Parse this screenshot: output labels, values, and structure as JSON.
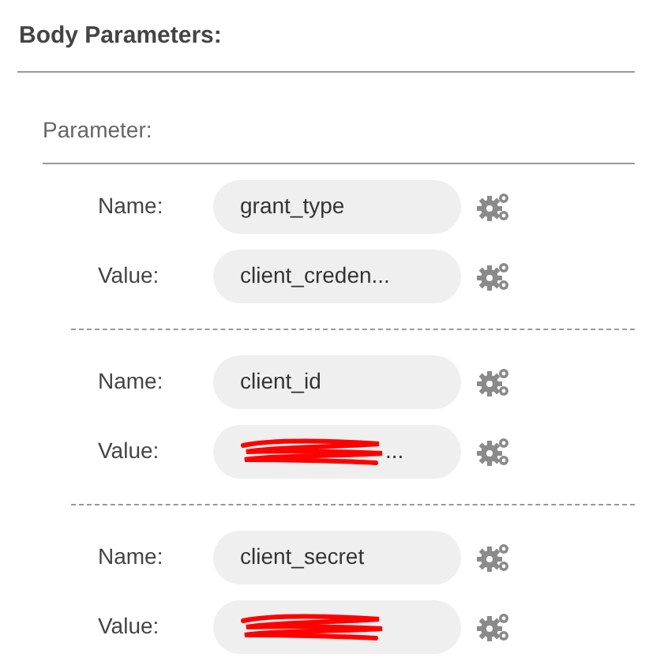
{
  "title": "Body Parameters:",
  "section_label": "Parameter:",
  "parameters": [
    {
      "name_label": "Name:",
      "name": {
        "value": "grant_type",
        "redacted": false
      },
      "value_label": "Value:",
      "value": {
        "value": "client_creden...",
        "redacted": false
      }
    },
    {
      "name_label": "Name:",
      "name": {
        "value": "client_id",
        "redacted": false
      },
      "value_label": "Value:",
      "value": {
        "value": "...",
        "redacted": true
      }
    },
    {
      "name_label": "Name:",
      "name": {
        "value": "client_secret",
        "redacted": false
      },
      "value_label": "Value:",
      "value": {
        "redacted": true
      }
    }
  ]
}
